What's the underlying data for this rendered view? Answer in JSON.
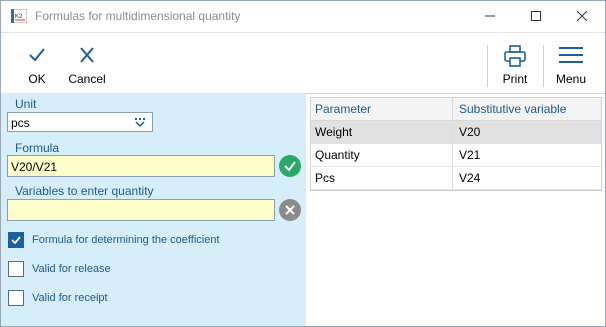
{
  "window": {
    "title": "Formulas for multidimensional quantity"
  },
  "toolbar": {
    "ok_label": "OK",
    "cancel_label": "Cancel",
    "print_label": "Print",
    "menu_label": "Menu"
  },
  "form": {
    "unit_label": "Unit",
    "unit_value": "pcs",
    "formula_label": "Formula",
    "formula_value": "V20/V21",
    "formula_status": "valid",
    "variables_label": "Variables to enter quantity",
    "variables_value": "",
    "variables_status": "invalid",
    "checkboxes": [
      {
        "label": "Formula for determining the coefficient",
        "checked": true
      },
      {
        "label": "Valid for release",
        "checked": false
      },
      {
        "label": "Valid for receipt",
        "checked": false
      }
    ]
  },
  "grid": {
    "columns": [
      "Parameter",
      "Substitutive variable"
    ],
    "rows": [
      {
        "parameter": "Weight",
        "variable": "V20",
        "selected": true
      },
      {
        "parameter": "Quantity",
        "variable": "V21",
        "selected": false
      },
      {
        "parameter": "Pcs",
        "variable": "V24",
        "selected": false
      }
    ]
  },
  "colors": {
    "panel_bg": "#d5eefa",
    "accent": "#1d5e9c",
    "valid": "#2aa86a",
    "invalid": "#8a8a8a",
    "input_yellow": "#ffffcc"
  },
  "icons": [
    "app-icon",
    "minimize-icon",
    "maximize-icon",
    "close-icon",
    "check-icon",
    "x-icon",
    "printer-icon",
    "hamburger-menu-icon",
    "dropdown-icon",
    "valid-check-icon",
    "invalid-x-icon",
    "checkbox-check-icon"
  ]
}
